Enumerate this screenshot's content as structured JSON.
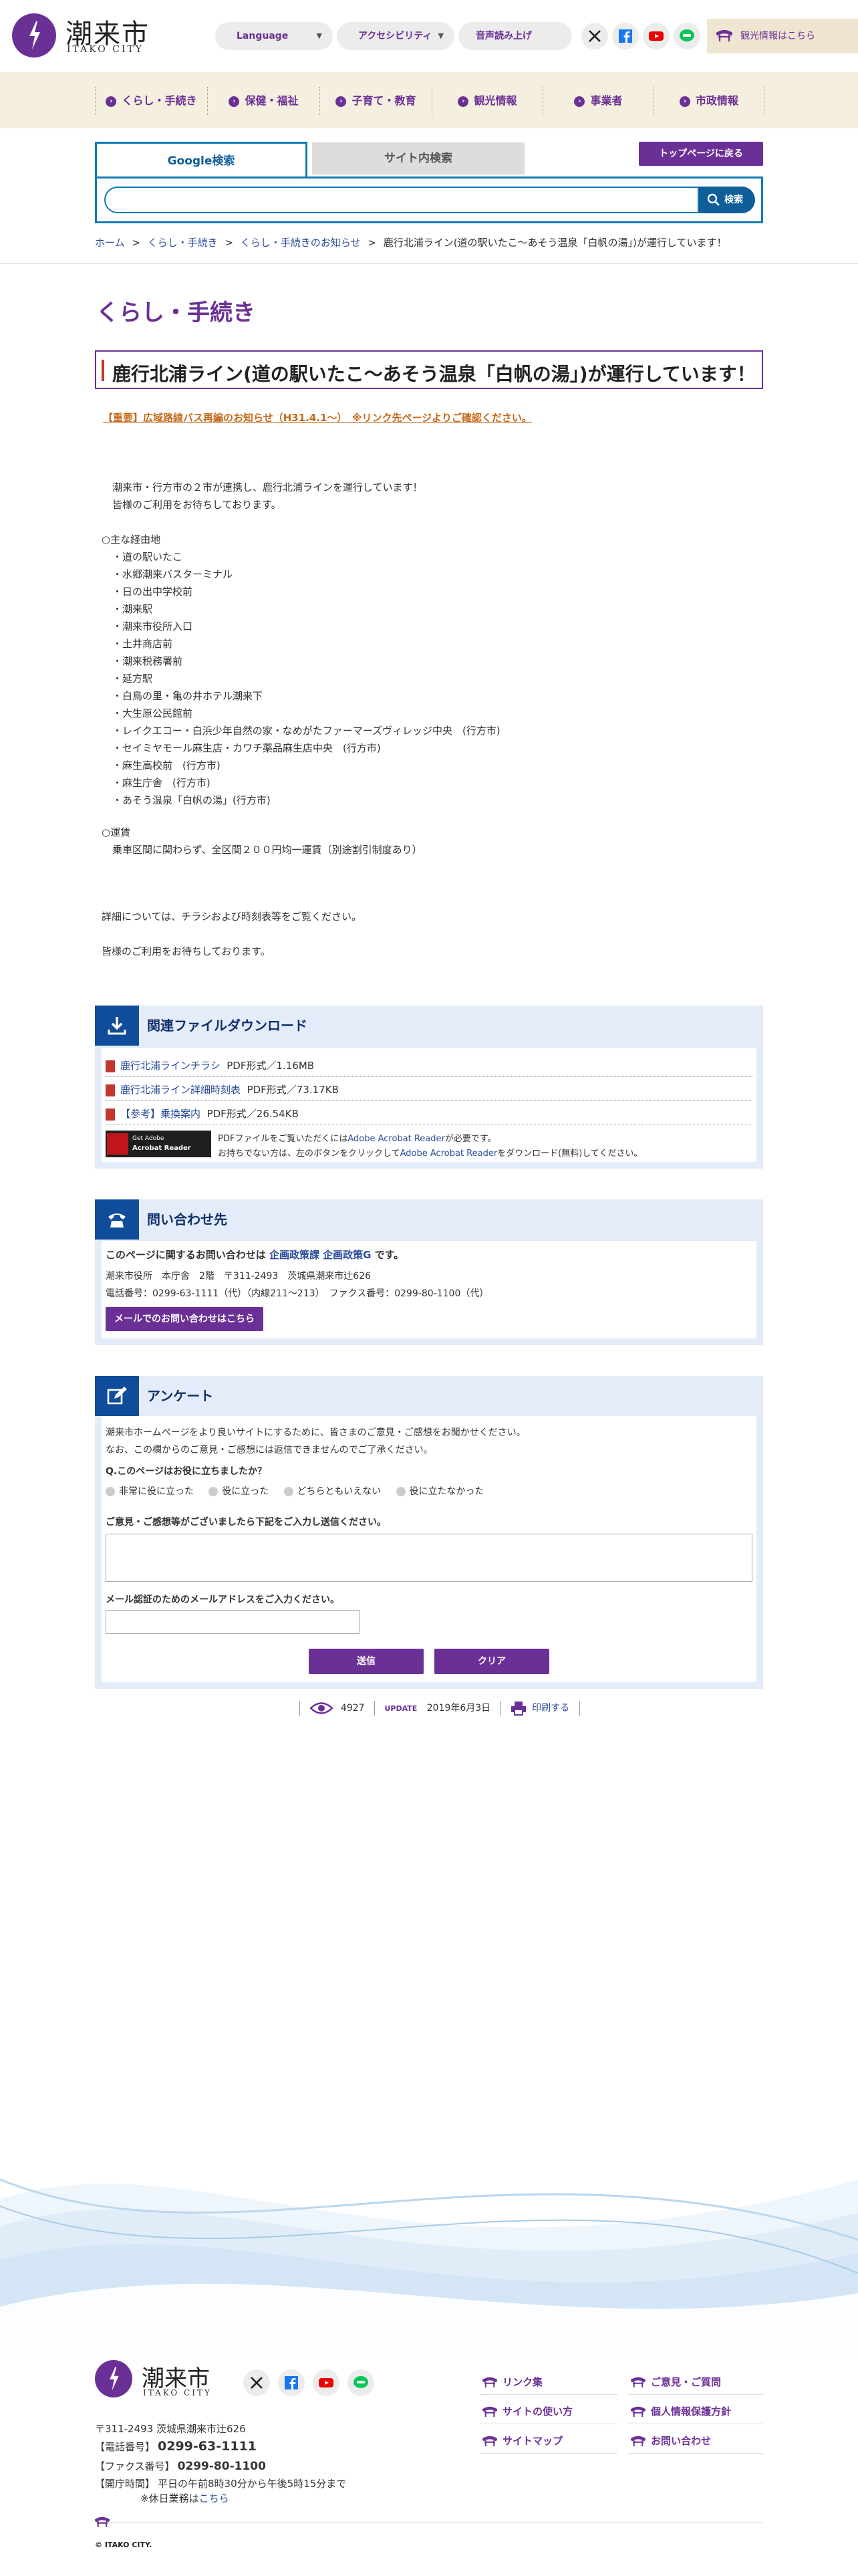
{
  "header": {
    "logo_jp": "潮来市",
    "logo_en": "ITAKO CITY",
    "language_label": "Language",
    "accessibility_label": "アクセシビリティ",
    "voice_label": "音声読み上げ",
    "kanko_label": "観光情報はこちら",
    "brand_color": "#6b3096"
  },
  "nav": {
    "items": [
      "くらし・手続き",
      "保健・福祉",
      "子育て・教育",
      "観光情報",
      "事業者",
      "市政情報"
    ]
  },
  "search": {
    "tab_google": "Google検索",
    "tab_site": "サイト内検索",
    "top_back": "トップページに戻る",
    "button_label": "検索",
    "placeholder": ""
  },
  "breadcrumb": {
    "home": "ホーム",
    "l1": "くらし・手続き",
    "l2": "くらし・手続きのお知らせ",
    "current": "鹿行北浦ライン(道の駅いたこ～あそう温泉「白帆の湯」)が運行しています！",
    "sep": ">"
  },
  "page": {
    "category": "くらし・手続き",
    "title": "鹿行北浦ライン(道の駅いたこ～あそう温泉「白帆の湯」)が運行しています！",
    "notice": "【重要】広域路線バス再編のお知らせ（H31.4.1～）　※リンク先ページよりご確認ください。",
    "intro": [
      "潮来市・行方市の２市が連携し、鹿行北浦ラインを運行しています！",
      "皆様のご利用をお待ちしております。"
    ],
    "route_heading": "○主な経由地",
    "route": [
      "・道の駅いたこ",
      "・水郷潮来バスターミナル",
      "・日の出中学校前",
      "・潮来駅",
      "・潮来市役所入口",
      "・土井商店前",
      "・潮来税務署前",
      "・延方駅",
      "・白鳥の里・亀の井ホテル潮来下",
      "・大生原公民館前",
      "・レイクエコー・白浜少年自然の家・なめがたファーマーズヴィレッジ中央　(行方市)",
      "・セイミヤモール麻生店・カワチ薬品麻生店中央　(行方市)",
      "・麻生高校前　(行方市)",
      "・麻生庁舎　(行方市)",
      "・あそう温泉「白帆の湯」(行方市)"
    ],
    "fare_heading": "○運賃",
    "fare": "乗車区間に関わらず、全区間２００円均一運賃（別途割引制度あり）",
    "detail": "詳細については、チラシおよび時刻表等をご覧ください。",
    "closing": "皆様のご利用をお待ちしております。"
  },
  "downloads": {
    "title": "関連ファイルダウンロード",
    "files": [
      {
        "name": "鹿行北浦ラインチラシ",
        "info": "PDF形式／1.16MB"
      },
      {
        "name": "鹿行北浦ライン詳細時刻表",
        "info": "PDF形式／73.17KB"
      },
      {
        "name": "【参考】乗換案内",
        "info": "PDF形式／26.54KB"
      }
    ],
    "adobe_badge_1": "Get Adobe",
    "adobe_badge_2": "Acrobat Reader",
    "acrobat_note_1a": "PDFファイルをご覧いただくには",
    "acrobat_link": "Adobe Acrobat Reader",
    "acrobat_note_1b": "が必要です。",
    "acrobat_note_2a": "お持ちでない方は、左のボタンをクリックして",
    "acrobat_note_2b": "をダウンロード(無料)してください。"
  },
  "contact": {
    "title": "問い合わせ先",
    "lead_a": "このページに関するお問い合わせは ",
    "dept": "企画政策課 企画政策G",
    "lead_b": " です。",
    "addr": "潮来市役所　本庁舎　2階　〒311-2493　茨城県潮来市辻626",
    "tel": "電話番号：0299-63-1111（代）（内線211～213）　ファクス番号：0299-80-1100（代）",
    "mail_button": "メールでのお問い合わせはこちら"
  },
  "survey": {
    "title": "アンケート",
    "intro1": "潮来市ホームページをより良いサイトにするために、皆さまのご意見・ご感想をお聞かせください。",
    "intro2": "なお、この欄からのご意見・ご感想には返信できませんのでご了承ください。",
    "question": "Q.このページはお役に立ちましたか？",
    "options": [
      "非常に役に立った",
      "役に立った",
      "どちらともいえない",
      "役に立たなかった"
    ],
    "comment_label": "ご意見・ご感想等がございましたら下記をご入力し送信ください。",
    "email_label": "メール認証のためのメールアドレスをご入力ください。",
    "submit": "送信",
    "clear": "クリア"
  },
  "counter": {
    "views": "4927",
    "update_label": "UPDATE",
    "update_date": "2019年6月3日",
    "print": "印刷する"
  },
  "footer": {
    "logo_jp": "潮来市",
    "logo_en": "ITAKO CITY",
    "links": [
      "リンク集",
      "ご意見・ご質問",
      "サイトの使い方",
      "個人情報保護方針",
      "サイトマップ",
      "お問い合わせ"
    ],
    "address": "〒311-2493 茨城県潮来市辻626",
    "tel_label": "【電話番号】",
    "tel": "0299-63-1111",
    "fax_label": "【ファクス番号】",
    "fax": "0299-80-1100",
    "hours_label": "【開庁時間】",
    "hours": "平日の午前8時30分から午後5時15分まで",
    "holiday_a": "※休日業務は",
    "holiday_link": "こちら",
    "copyright": "© ITAKO CITY."
  }
}
